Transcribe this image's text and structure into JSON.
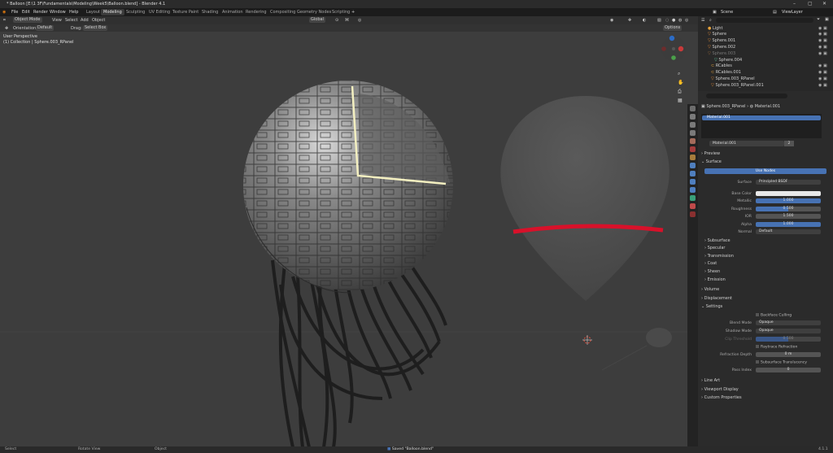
{
  "window": {
    "title": "* Balloon [E:\\1 3F\\Fundamentals\\Modeling\\Week5\\Balloon.blend] - Blender 4.1"
  },
  "menus": [
    "File",
    "Edit",
    "Render",
    "Window",
    "Help"
  ],
  "workspaces": [
    "Layout",
    "Modeling",
    "Sculpting",
    "UV Editing",
    "Texture Paint",
    "Shading",
    "Animation",
    "Rendering",
    "Compositing",
    "Geometry Nodes",
    "Scripting"
  ],
  "active_workspace": "Modeling",
  "scene": "Scene",
  "view_layer": "ViewLayer",
  "viewport": {
    "mode": "Object Mode",
    "menus": [
      "View",
      "Select",
      "Add",
      "Object"
    ],
    "orientation_label": "Orientation:",
    "orientation": "Default",
    "drag_label": "Drag:",
    "drag": "Select Box",
    "transform": "Global",
    "options": "Options",
    "overlay_line1": "User Perspective",
    "overlay_line2": "(1) Collection | Sphere.003_RPanel"
  },
  "outliner": {
    "search_placeholder": "",
    "items": [
      "Light",
      "Sphere",
      "Sphere.001",
      "Sphere.002",
      "Sphere.003",
      "Sphere.004",
      "RCables",
      "RCables.001",
      "Sphere.003_RPanel",
      "Sphere.003_RPanel.001"
    ]
  },
  "properties": {
    "breadcrumb_object": "Sphere.003_RPanel",
    "breadcrumb_material": "Material.001",
    "slot": "Material.001",
    "material_name": "Material.001",
    "users": "2",
    "sections": {
      "preview": "Preview",
      "surface": "Surface",
      "use_nodes": "Use Nodes",
      "surface_label": "Surface",
      "surface_value": "Principled BSDF",
      "base_color": "Base Color",
      "metallic": "Metallic",
      "metallic_val": "1.000",
      "roughness": "Roughness",
      "roughness_val": "0.500",
      "ior": "IOR",
      "ior_val": "1.500",
      "alpha": "Alpha",
      "alpha_val": "1.000",
      "normal": "Normal",
      "normal_val": "Default",
      "subsurface": "Subsurface",
      "specular": "Specular",
      "transmission": "Transmission",
      "coat": "Coat",
      "sheen": "Sheen",
      "emission": "Emission",
      "volume": "Volume",
      "displacement": "Displacement",
      "settings": "Settings",
      "backface": "Backface Culling",
      "blend_mode": "Blend Mode",
      "blend_val": "Opaque",
      "shadow_mode": "Shadow Mode",
      "shadow_val": "Opaque",
      "clip": "Clip Threshold",
      "clip_val": "0.500",
      "raytrace": "Raytrace Refraction",
      "refraction_depth": "Refraction Depth",
      "refraction_val": "0 m",
      "subsurface_trans": "Subsurface Translucency",
      "pass_index": "Pass Index",
      "pass_val": "0",
      "line_art": "Line Art",
      "viewport_display": "Viewport Display",
      "custom_props": "Custom Properties"
    }
  },
  "status": {
    "select": "Select",
    "rotate": "Rotate View",
    "object": "Object",
    "saved": "Saved \"Balloon.blend\"",
    "version": "4.1.1"
  },
  "colors": {
    "accent": "#4772b3",
    "highlight_line": "#f3efc0",
    "red_band": "#d8112a"
  }
}
